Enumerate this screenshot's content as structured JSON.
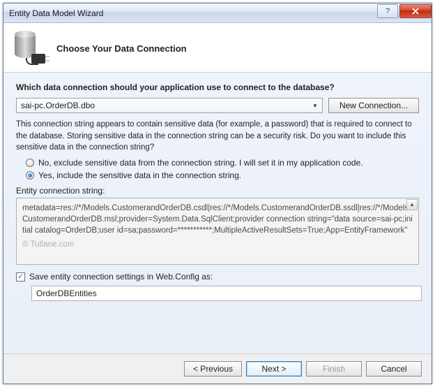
{
  "window": {
    "title": "Entity Data Model Wizard"
  },
  "header": {
    "title": "Choose Your Data Connection"
  },
  "question": "Which data connection should your application use to connect to the database?",
  "connection": {
    "selected": "sai-pc.OrderDB.dbo",
    "new_button": "New Connection..."
  },
  "info": "This connection string appears to contain sensitive data (for example, a password) that is required to connect to the database. Storing sensitive data in the connection string can be a security risk. Do you want to include this sensitive data in the connection string?",
  "radios": {
    "exclude": "No, exclude sensitive data from the connection string. I will set it in my application code.",
    "include": "Yes, include the sensitive data in the connection string."
  },
  "conn_label": "Entity connection string:",
  "conn_string": "metadata=res://*/Models.CustomerandOrderDB.csdl|res://*/Models.CustomerandOrderDB.ssdl|res://*/Models.CustomerandOrderDB.msl;provider=System.Data.SqlClient;provider connection string=\"data source=sai-pc;initial catalog=OrderDB;user id=sa;password=***********;MultipleActiveResultSets=True;App=EntityFramework\"",
  "watermark": "© Tutlane.com",
  "save_label": "Save entity connection settings in Web.Config as:",
  "save_value": "OrderDBEntities",
  "buttons": {
    "previous": "< Previous",
    "next": "Next >",
    "finish": "Finish",
    "cancel": "Cancel"
  }
}
